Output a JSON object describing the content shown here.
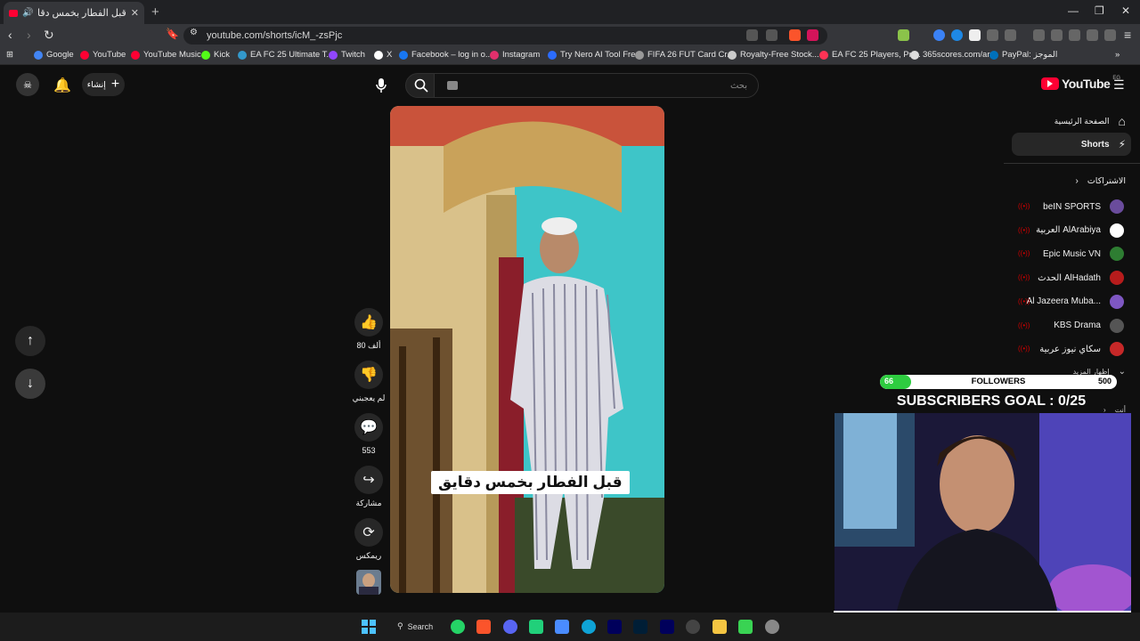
{
  "browser": {
    "tab_title": "قبل الفطار بخمس دقايق - YouTube",
    "url": "youtube.com/shorts/icM_-zsPjc",
    "bookmarks": [
      {
        "label": "Google",
        "color": "#4285f4"
      },
      {
        "label": "YouTube",
        "color": "#ff0033"
      },
      {
        "label": "YouTube Music",
        "color": "#ff0033"
      },
      {
        "label": "Kick",
        "color": "#53fc18"
      },
      {
        "label": "EA FC 25 Ultimate T...",
        "color": "#39c"
      },
      {
        "label": "Twitch",
        "color": "#9146ff"
      },
      {
        "label": "X",
        "color": "#ffffff"
      },
      {
        "label": "Facebook – log in o...",
        "color": "#1877f2"
      },
      {
        "label": "Instagram",
        "color": "#e1306c"
      },
      {
        "label": "Try Nero AI Tool Fre...",
        "color": "#2b6cff"
      },
      {
        "label": "FIFA 26 FUT Card Cr...",
        "color": "#999999"
      },
      {
        "label": "Royalty-Free Stock...",
        "color": "#cccccc"
      },
      {
        "label": "EA FC 25 Players, Pri...",
        "color": "#ff3355"
      },
      {
        "label": "365scores.com/ar",
        "color": "#dddddd"
      },
      {
        "label": "PayPal: الموجز",
        "color": "#0070ba"
      }
    ]
  },
  "youtube": {
    "logo_text": "YouTube",
    "logo_region": "EG",
    "create_label": "إنشاء",
    "search_placeholder": "بحث",
    "sidebar": {
      "home": "الصفحة الرئيسية",
      "shorts": "Shorts",
      "subscriptions": "الاشتراكات",
      "show_more": "إظهار المزيد",
      "you": "أنت",
      "channels": [
        {
          "name": "beIN SPORTS",
          "color": "#6a4c9c"
        },
        {
          "name": "العربية AlArabiya",
          "color": "#ffffff"
        },
        {
          "name": "Epic Music VN",
          "color": "#2e7d32"
        },
        {
          "name": "الحدث AlHadath",
          "color": "#b71c1c"
        },
        {
          "name": "Al Jazeera Muba...",
          "color": "#7e57c2"
        },
        {
          "name": "KBS Drama",
          "color": "#555555"
        },
        {
          "name": "سكاي نيوز عربية",
          "color": "#c62828"
        }
      ]
    },
    "short": {
      "caption": "قبل الفطار بخمس دقايق",
      "likes": "80 ألف",
      "dislike_label": "لم يعجبني",
      "comments": "553",
      "share_label": "مشاركة",
      "remix_label": "ريمكس"
    }
  },
  "overlay": {
    "followers_current": "66",
    "followers_label": "FOLLOWERS",
    "followers_goal": "500",
    "followers_progress": 0.132,
    "subscribers_goal": "SUBSCRIBERS GOAL : 0/25"
  },
  "taskbar": {
    "search_label": "Search"
  }
}
